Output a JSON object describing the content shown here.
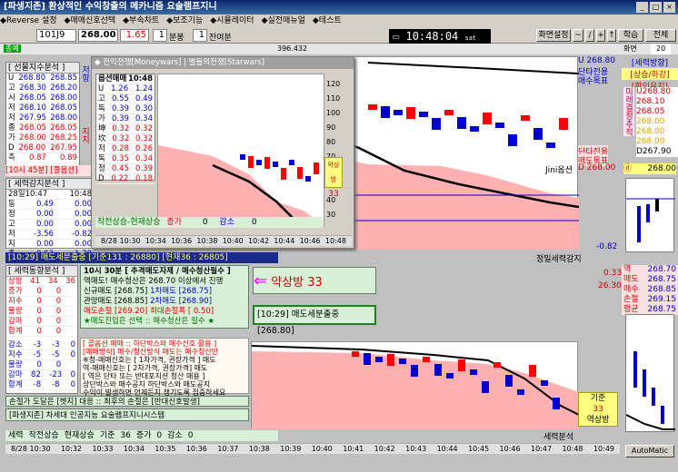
{
  "title": "[파생지존] 환상적인 수익창출의 메카니즘 요술램프지니",
  "menu": [
    "◆Reverse 설정",
    "◆매매신호선택",
    "◆부속차트",
    "◆보조기능",
    "◆시뮬레이터",
    "◆실전매뉴얼",
    "◆테스트"
  ],
  "toolbar": {
    "code": "101J9",
    "price": "268.00",
    "change": "1.65",
    "interval": "1",
    "unit": "분봉",
    "jan": "1",
    "jan_label": "잔여분",
    "clock": "10:48:04",
    "sat": "sat",
    "popup": "화면설정",
    "plus": "+",
    "arrows": "↑",
    "learn": "학습",
    "display": "전체",
    "screen_label": "화면",
    "screen_num": "20"
  },
  "ribbon": {
    "left": "종예",
    "mid": "396.432"
  },
  "left_top": {
    "title": "[ 선물지수분석 ]",
    "rows": [
      [
        "U",
        "268.80",
        "268.85"
      ],
      [
        "고",
        "268.30",
        "268.20"
      ],
      [
        "시",
        "268.05",
        "268.00"
      ],
      [
        "저",
        "268.10",
        "268.05"
      ],
      [
        "저",
        "267.95",
        "268.00"
      ],
      [
        "종",
        "268.05",
        "268.05"
      ],
      [
        "가",
        "268.00",
        "268.25"
      ],
      [
        "D",
        "268.00",
        "267.95"
      ],
      [
        "측",
        "0.87",
        "0.89"
      ]
    ],
    "side": "저항",
    "side2": "지지",
    "footer": "[10시 45분] [콜옵션]"
  },
  "left_mid": {
    "title": "[ 세력감지분석 ]",
    "time": "28일10:47",
    "val": "10:48",
    "rows": [
      [
        "동",
        "0.49",
        "0.00"
      ],
      [
        "정",
        "0.00",
        "0.00"
      ],
      [
        "고",
        "0.00",
        "0.00"
      ],
      [
        "저",
        "-3.56",
        "-0.82"
      ],
      [
        "지",
        "0.00",
        "0.00"
      ],
      [
        "측",
        "-0.63",
        "-1.78"
      ]
    ]
  },
  "overlay": {
    "tabs": "◆ 전익전쟁[Moneywars] | 별들의전쟁[Starwars]",
    "head": "옵션매매",
    "time": "10:48",
    "rows": [
      [
        "U",
        "1.26",
        "1.24"
      ],
      [
        "고",
        "0.55",
        "0.49"
      ],
      [
        "독",
        "0.39",
        "0.30"
      ],
      [
        "가",
        "0.39",
        "0.34"
      ],
      [
        "坤",
        "0.32",
        "0.32"
      ],
      [
        "坎",
        "0.32",
        "0.32"
      ],
      [
        "저",
        "0.28",
        "0.26"
      ],
      [
        "독",
        "0.35",
        "0.34"
      ],
      [
        "정",
        "0.45",
        "0.39"
      ],
      [
        "D",
        "0.22",
        "0.18"
      ]
    ],
    "axis": [
      "120",
      "110",
      "100",
      "90",
      "80",
      "70",
      "60",
      "50",
      "40",
      "30"
    ],
    "badge": "약상방",
    "badge_num": "33",
    "status": "작전상승-현재상승",
    "buy": "증가",
    "buy_val": "0",
    "sell": "감소",
    "sell_val": "0",
    "times": [
      "8/28 10:30",
      "10:34",
      "10:36",
      "10:38",
      "10:40",
      "10:42",
      "10:44",
      "10:46",
      "10:48"
    ]
  },
  "upper_chart": {
    "label_u": "U 268.80",
    "label1": "단타전용",
    "label2": "매수목표",
    "label3": "단타전용",
    "label4": "매도목표",
    "label_d": "D 268.00",
    "jini": "Jini옵션",
    "val": "-0.82",
    "status": "정밀세력감지"
  },
  "mid_bar": {
    "text": "[10:29] 매도세분출중 [기준131 : 26880] [현재36 : 26805]"
  },
  "signal_panel": {
    "title": "[ 세력동향분석 ]",
    "rows": [
      [
        "상방",
        "41",
        "34",
        "36"
      ],
      [
        "증가",
        "0",
        "0",
        ""
      ],
      [
        "지수",
        "0",
        "0",
        ""
      ],
      [
        "물량",
        "0",
        "0",
        ""
      ],
      [
        "감마",
        "0",
        "0",
        ""
      ],
      [
        "합계",
        "0",
        "0",
        ""
      ]
    ],
    "rows2": [
      [
        "감소",
        "-3",
        "-3",
        "0"
      ],
      [
        "지수",
        "-5",
        "-5",
        "0"
      ],
      [
        "물량",
        "0",
        "0",
        ""
      ],
      [
        "감마",
        "82",
        "-23",
        "0"
      ],
      [
        "합계",
        "-8",
        "-8",
        "0"
      ]
    ]
  },
  "info_box": {
    "line1": "10시 30분 [ 추격매도자제 / 매수청산필수 ]",
    "line2": "역매도! 매수청산은 268.70 이상에서 진행",
    "l3a": "신규매도",
    "l3b": "[268.75]",
    "l3c": "1차매도",
    "l3d": "[268.75]",
    "l4a": "관망매도",
    "l4b": "[268.85]",
    "l4c": "2차매도",
    "l4d": "[268.90]",
    "l5a": "매도손절",
    "l5b": "[269.20]",
    "l5c": "최대손절폭",
    "l5d": "[ 0.50]",
    "l6": "★매도진입은 선택 :: 매수청산은 필수 ★",
    "arrow_text": "약상방 33",
    "box2": "[10:29] 매도세분출중[268.80]"
  },
  "info_box2": {
    "t1": "[ 콜옵션 매매 :: 하단박스와 매수신호 활용 ]",
    "t2": "[매매방식] 매수/청산방식 매도는 매수청산만",
    "t3": "※청-매매신호는 [ 1차가격, 권장가격 ] 매도",
    "t4": "역-매매신호는 [ 2차가격, 권장가격] 매도",
    "t5": "[ 역은 단타 또는 반대포지션 청산 매용 ]",
    "t6": "상단박스와 매수공지 하단박스와 매도공지",
    "t7": "수익이 발생하면 언제든지 챙기도록 집중하세요",
    "t8": "손절가 도달은 [헷지] 대응 :: 최후의 손절은 [반대신호발생]",
    "t9": "[파생지존] 차세대 인공지능 요술램프지니시스템"
  },
  "lower_chart": {
    "right_a": "0.33",
    "right_b": "26.30",
    "label": "세력분석",
    "box": "기준",
    "box2": "33",
    "box3": "역상방",
    "labels": [
      "세력",
      "작전상승",
      "현재상승",
      "기준",
      "36",
      "증가",
      "0",
      "감소",
      "0"
    ],
    "times": [
      "8/28 10:30",
      "10:32",
      "10:33",
      "10:34",
      "10:35",
      "10:36",
      "10:37",
      "10:38",
      "10:39",
      "10:40",
      "10:41",
      "10:42",
      "10:43",
      "10:44",
      "10:45",
      "10:46",
      "10:47",
      "10:48",
      "10:49"
    ]
  },
  "right_col": {
    "title": "[세력방향]",
    "title2": "[상승/하강]",
    "title3": "[확인유지]",
    "rows": [
      "U268.80",
      "268.10",
      "268.05",
      "268.00",
      "268.00",
      "268.00",
      "D267.90"
    ],
    "side": "미래결정추적",
    "status": "268.00",
    "bottom": [
      "역",
      "268.70",
      "매도",
      "268.75",
      "매수",
      "268.85",
      "손절",
      "269.15",
      "평균",
      "268.75"
    ],
    "auto": "AutoMatic"
  }
}
